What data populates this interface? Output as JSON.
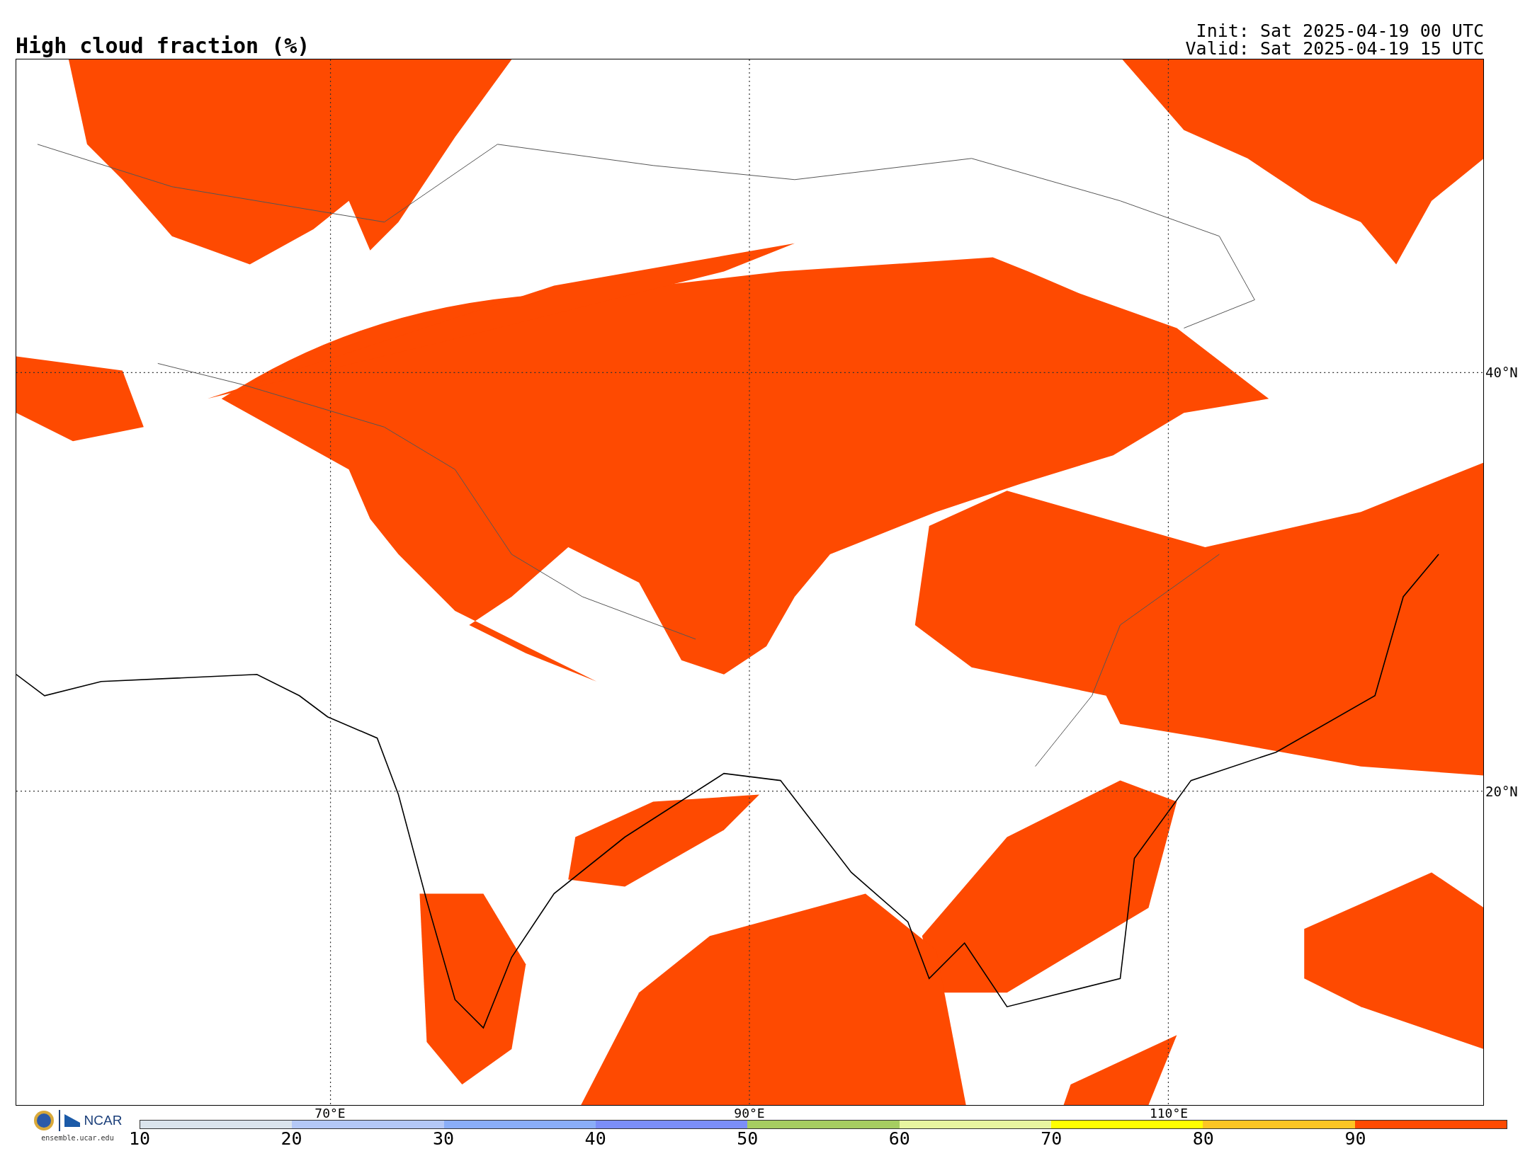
{
  "title": "High cloud fraction (%)",
  "run_info": [
    "Init: Sat 2025-04-19 00 UTC",
    "Valid: Sat 2025-04-19 15 UTC"
  ],
  "map": {
    "latitude_labels": [
      "40°N",
      "20°N"
    ],
    "longitude_labels": [
      "70°E",
      "90°E",
      "110°E"
    ]
  },
  "logo": {
    "name": "NCAR",
    "site": "ensemble.ucar.edu"
  },
  "colorbar": {
    "ticks": [
      "10",
      "20",
      "30",
      "40",
      "50",
      "60",
      "70",
      "80",
      "90"
    ],
    "segments": [
      {
        "color": "#dbe4ec"
      },
      {
        "color": "#b4c8f6"
      },
      {
        "color": "#8aaef8"
      },
      {
        "color": "#7b8ef8"
      },
      {
        "color": "#a6cd61"
      },
      {
        "color": "#e8f5a0"
      },
      {
        "color": "#ffff00"
      },
      {
        "color": "#fcc524"
      },
      {
        "color": "#fe4a01"
      }
    ]
  }
}
